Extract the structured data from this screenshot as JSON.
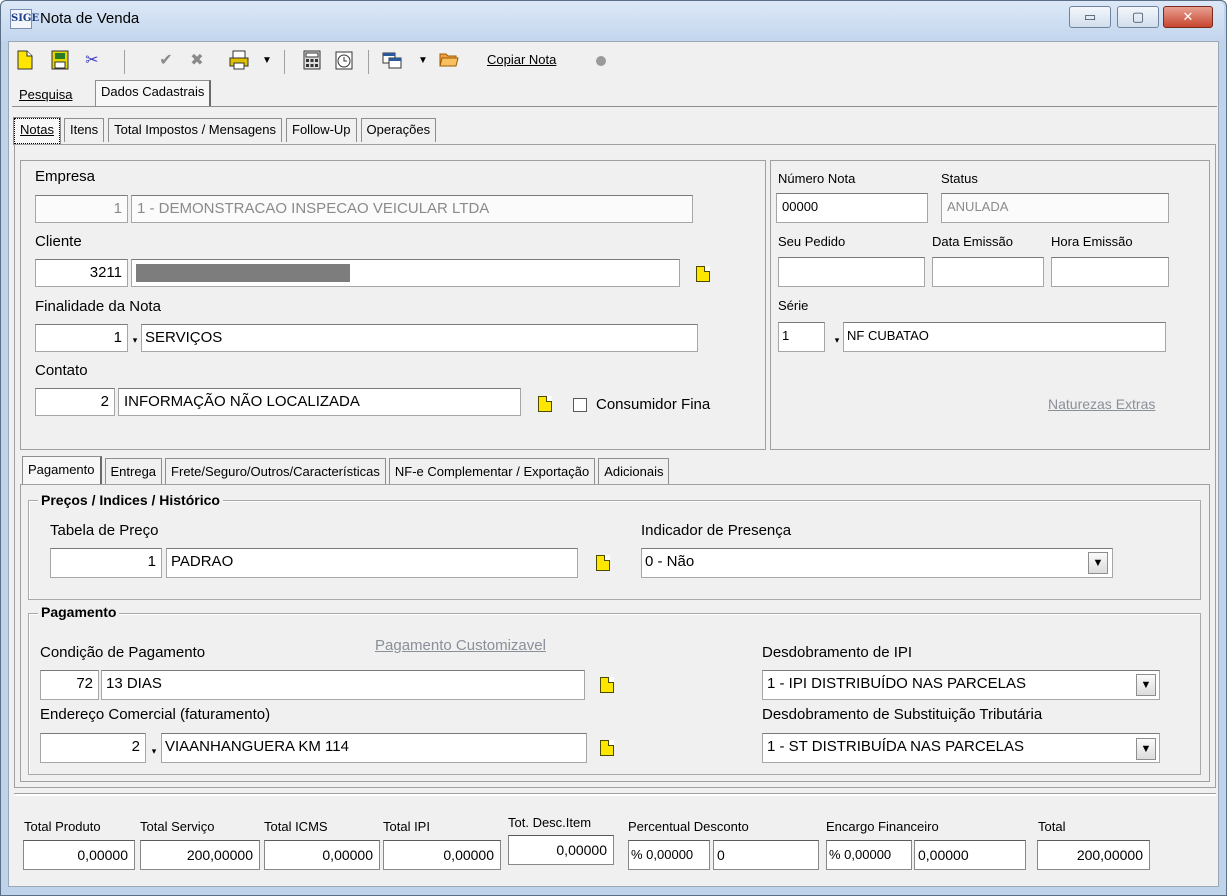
{
  "window": {
    "title": "Nota de Venda",
    "app_icon_text": "SIGE",
    "min_icon": "▭",
    "max_icon": "▢",
    "close_icon": "✕"
  },
  "toolbar": {
    "copiar_nota": "Copiar Nota",
    "icons": [
      "new-doc-icon",
      "save-icon",
      "cut-icon",
      "confirm-icon",
      "cancel-icon",
      "print-icon",
      "calculator-icon",
      "clock-icon",
      "window-icon",
      "open-folder-icon",
      "status-dot-icon"
    ]
  },
  "main_tabs": [
    "Pesquisa",
    "Dados Cadastrais"
  ],
  "sub_tabs": [
    "Notas",
    "Itens",
    "Total Impostos / Mensagens",
    "Follow-Up",
    "Operações"
  ],
  "empresa": {
    "label": "Empresa",
    "code": "1",
    "name": "1                 - DEMONSTRACAO INSPECAO VEICULAR LTDA"
  },
  "cliente": {
    "label": "Cliente",
    "code": "3211",
    "name": ""
  },
  "finalidade": {
    "label": "Finalidade da Nota",
    "code": "1",
    "value": "SERVIÇOS"
  },
  "contato": {
    "label": "Contato",
    "code": "2",
    "value": "INFORMAÇÃO NÃO LOCALIZADA",
    "consumidor_final_label": "Consumidor Fina"
  },
  "right_panel": {
    "numero_nota_label": "Número Nota",
    "numero_nota": "00000",
    "status_label": "Status",
    "status": "ANULADA",
    "seu_pedido_label": "Seu Pedido",
    "seu_pedido": "",
    "data_emissao_label": "Data Emissão",
    "data_emissao": "",
    "hora_emissao_label": "Hora Emissão",
    "hora_emissao": "",
    "serie_label": "Série",
    "serie_code": "1",
    "serie_value": "NF CUBATAO",
    "naturezas_extras": "Naturezas Extras"
  },
  "payment_tabs": [
    "Pagamento",
    "Entrega",
    "Frete/Seguro/Outros/Características",
    "NF-e Complementar / Exportação",
    "Adicionais"
  ],
  "precos": {
    "group_title": "Preços / Indices / Histórico",
    "tabela_label": "Tabela de Preço",
    "tabela_code": "1",
    "tabela_value": "PADRAO",
    "indicador_label": "Indicador de Presença",
    "indicador_value": "0 - Não"
  },
  "pagamento": {
    "group_title": "Pagamento",
    "condicao_label": "Condição de Pagamento",
    "pagamento_customizavel": "Pagamento Customizavel",
    "condicao_code": "72",
    "condicao_value": "13 DIAS",
    "endereco_label": "Endereço Comercial (faturamento)",
    "endereco_code": "2",
    "endereco_value": "VIAANHANGUERA KM 114",
    "desdobramento_ipi_label": "Desdobramento de IPI",
    "desdobramento_ipi_value": "1 - IPI DISTRIBUÍDO NAS PARCELAS",
    "desdobramento_st_label": "Desdobramento de Substituição Tributária",
    "desdobramento_st_value": "1 - ST DISTRIBUÍDA NAS PARCELAS"
  },
  "totals": {
    "total_produto_label": "Total Produto",
    "total_produto": "0,00000",
    "total_servico_label": "Total Serviço",
    "total_servico": "200,00000",
    "total_icms_label": "Total ICMS",
    "total_icms": "0,00000",
    "total_ipi_label": "Total IPI",
    "total_ipi": "0,00000",
    "tot_desc_item_label": "Tot. Desc.Item",
    "tot_desc_item": "0,00000",
    "percentual_desconto_label": "Percentual Desconto",
    "percentual_desconto_pct": "% 0,00000",
    "percentual_desconto_val": "0",
    "encargo_label": "Encargo Financeiro",
    "encargo_pct": "% 0,00000",
    "encargo_val": "0,00000",
    "total_label": "Total",
    "total": "200,00000"
  }
}
